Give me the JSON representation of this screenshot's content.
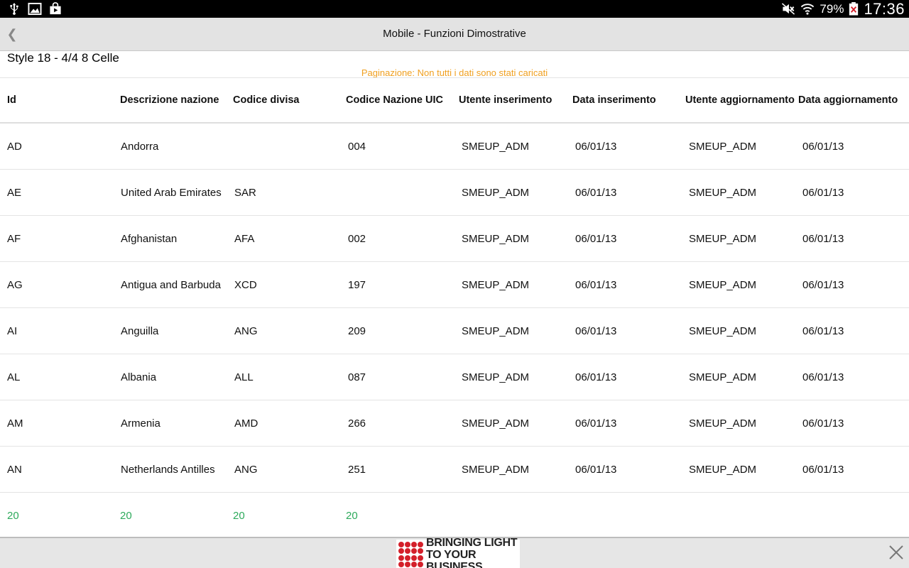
{
  "status_bar": {
    "battery_percent": "79%",
    "time": "17:36",
    "left_icons": [
      "usb-icon",
      "image-icon",
      "store-bag-icon"
    ],
    "right_icons": [
      "mute-icon",
      "wifi-icon",
      "battery-icon"
    ]
  },
  "title_bar": {
    "back_glyph": "❮",
    "title": "Mobile - Funzioni Dimostrative"
  },
  "style_label": "Style 18 - 4/4 8 Celle",
  "pagination_note": "Paginazione: Non tutti i dati sono stati caricati",
  "table": {
    "headers": [
      "Id",
      "Descrizione nazione",
      "Codice divisa",
      "Codice Nazione  UIC",
      "Utente inserimento",
      "Data inserimento",
      "Utente aggiornamento",
      "Data aggiornamento"
    ],
    "rows": [
      [
        "AD",
        "Andorra",
        "",
        "004",
        "SMEUP_ADM",
        "06/01/13",
        "SMEUP_ADM",
        "06/01/13"
      ],
      [
        "AE",
        "United Arab Emirates",
        "SAR",
        "",
        "SMEUP_ADM",
        "06/01/13",
        "SMEUP_ADM",
        "06/01/13"
      ],
      [
        "AF",
        "Afghanistan",
        "AFA",
        "002",
        "SMEUP_ADM",
        "06/01/13",
        "SMEUP_ADM",
        "06/01/13"
      ],
      [
        "AG",
        "Antigua and Barbuda",
        "XCD",
        "197",
        "SMEUP_ADM",
        "06/01/13",
        "SMEUP_ADM",
        "06/01/13"
      ],
      [
        "AI",
        "Anguilla",
        "ANG",
        "209",
        "SMEUP_ADM",
        "06/01/13",
        "SMEUP_ADM",
        "06/01/13"
      ],
      [
        "AL",
        "Albania",
        "ALL",
        "087",
        "SMEUP_ADM",
        "06/01/13",
        "SMEUP_ADM",
        "06/01/13"
      ],
      [
        "AM",
        "Armenia",
        "AMD",
        "266",
        "SMEUP_ADM",
        "06/01/13",
        "SMEUP_ADM",
        "06/01/13"
      ],
      [
        "AN",
        "Netherlands Antilles",
        "ANG",
        "251",
        "SMEUP_ADM",
        "06/01/13",
        "SMEUP_ADM",
        "06/01/13"
      ]
    ],
    "footer": [
      "20",
      "20",
      "20",
      "20",
      "",
      "",
      "",
      ""
    ],
    "footer_color": "#2eaa5c"
  },
  "ad": {
    "line1": "BRINGING LIGHT",
    "line2": "TO YOUR BUSINESS",
    "brand_color": "#d4202a"
  },
  "colors": {
    "title_bar_bg": "#e3e3e3",
    "pagination_note": "#f0a020"
  }
}
